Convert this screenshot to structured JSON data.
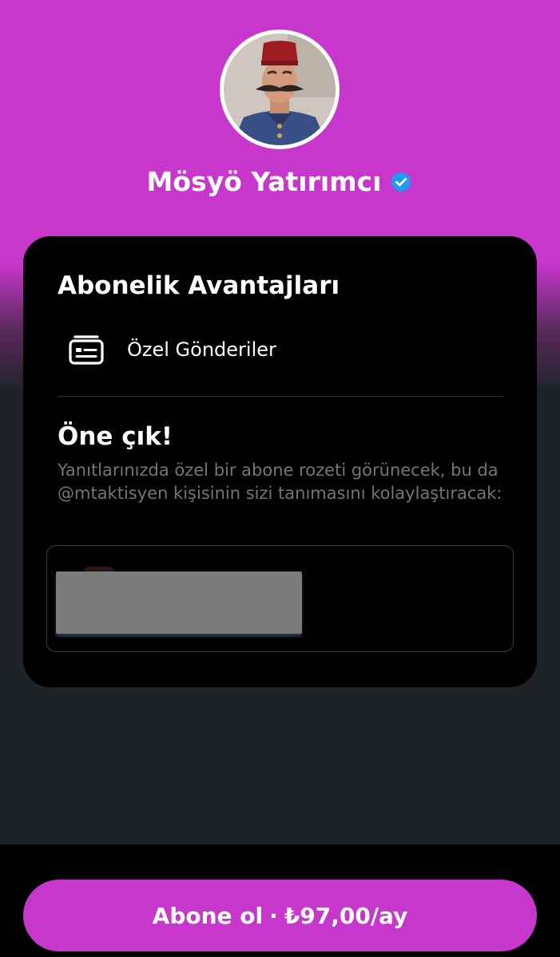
{
  "profile": {
    "name": "Mösyö Yatırımcı",
    "verified": true,
    "verified_color": "#1d9bf0",
    "avatar_icon": "avatar-portrait-fez"
  },
  "benefits": {
    "title": "Abonelik Avantajları",
    "items": [
      {
        "icon": "subscriber-posts-icon",
        "label": "Özel Gönderiler"
      }
    ]
  },
  "highlight": {
    "title": "Öne çık!",
    "description": "Yanıtlarınızda özel bir abone rozeti görünecek, bu da @mtaktisyen kişisinin sizi tanımasını kolaylaştıracak:"
  },
  "subscribe": {
    "label": "Abone ol",
    "separator": "·",
    "price": "₺97,00/ay"
  },
  "theme": {
    "accent": "#c837cc",
    "card_bg": "#000000",
    "page_bg": "#1f2328",
    "muted_text": "#71767b"
  }
}
